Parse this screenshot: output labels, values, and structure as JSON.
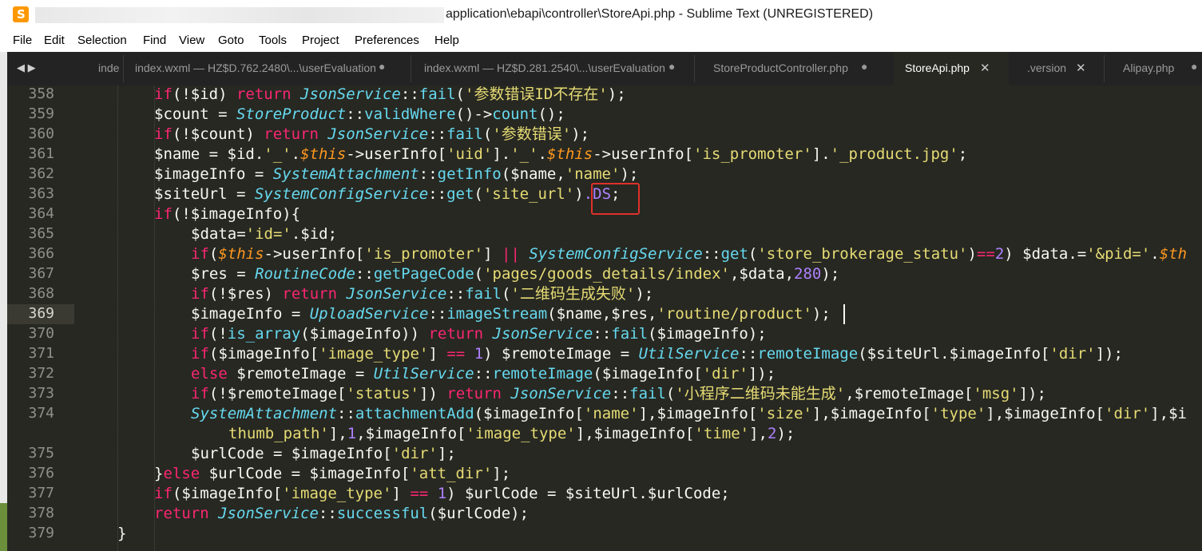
{
  "window": {
    "title": "application\\ebapi\\controller\\StoreApi.php - Sublime Text (UNREGISTERED)",
    "icon": "sublime-icon"
  },
  "menu": [
    "File",
    "Edit",
    "Selection",
    "Find",
    "View",
    "Goto",
    "Tools",
    "Project",
    "Preferences",
    "Help"
  ],
  "tabs": {
    "partial": "inde",
    "items": [
      {
        "label": "index.wxml — HZ$D.762.2480\\...\\userEvaluation",
        "state": "modified"
      },
      {
        "label": "index.wxml — HZ$D.281.2540\\...\\userEvaluation",
        "state": "modified"
      },
      {
        "label": "StoreProductController.php",
        "state": "modified"
      },
      {
        "label": "StoreApi.php",
        "state": "active"
      },
      {
        "label": ".version",
        "state": "close"
      },
      {
        "label": "Alipay.php",
        "state": "modified"
      }
    ]
  },
  "gutter": {
    "line_numbers": [
      "358",
      "359",
      "360",
      "361",
      "362",
      "363",
      "364",
      "365",
      "366",
      "367",
      "368",
      "369",
      "370",
      "371",
      "372",
      "373",
      "374",
      "375",
      "376",
      "377",
      "378",
      "379"
    ],
    "current_line": "369"
  },
  "code": {
    "l358": [
      "if(!$id) ",
      "return ",
      "JsonService",
      "::",
      "fail",
      "(",
      "'参数错误ID不存在'",
      ");"
    ],
    "l359": [
      "$count = ",
      "StoreProduct",
      "::",
      "validWhere",
      "()->",
      "count",
      "();"
    ],
    "l360": [
      "if(!$count) ",
      "return ",
      "JsonService",
      "::",
      "fail",
      "(",
      "'参数错误'",
      ");"
    ],
    "l361": [
      "$name = $id.",
      "'_'",
      ".",
      "$this",
      "->userInfo[",
      "'uid'",
      "].",
      "'_'",
      ".",
      "$this",
      "->userInfo[",
      "'is_promoter'",
      "].",
      "'_product.jpg'",
      ";"
    ],
    "l362": [
      "$imageInfo = ",
      "SystemAttachment",
      "::",
      "getInfo",
      "($name,",
      "'name'",
      ");"
    ],
    "l363": [
      "$siteUrl = ",
      "SystemConfigService",
      "::",
      "get",
      "(",
      "'site_url'",
      ")",
      ".DS",
      ";"
    ],
    "l364": [
      "if(!$imageInfo){"
    ],
    "l365": [
      "$data=",
      "'id='",
      ".$id;"
    ],
    "l366": [
      "if(",
      "$this",
      "->userInfo[",
      "'is_promoter'",
      "] ",
      "||",
      " ",
      "SystemConfigService",
      "::",
      "get",
      "(",
      "'store_brokerage_statu'",
      ")",
      "==",
      "2",
      ") $data.=",
      "'&pid='",
      ".",
      "$th"
    ],
    "l367": [
      "$res = ",
      "RoutineCode",
      "::",
      "getPageCode",
      "(",
      "'pages/goods_details/index'",
      ",$data,",
      "280",
      ");"
    ],
    "l368": [
      "if(!$res) ",
      "return ",
      "JsonService",
      "::",
      "fail",
      "(",
      "'二维码生成失败'",
      ");"
    ],
    "l369": [
      "$imageInfo = ",
      "UploadService",
      "::",
      "imageStream",
      "($name,$res,",
      "'routine/product'",
      ");"
    ],
    "l370": [
      "if(!",
      "is_array",
      "($imageInfo)) ",
      "return ",
      "JsonService",
      "::",
      "fail",
      "($imageInfo);"
    ],
    "l371": [
      "if($imageInfo[",
      "'image_type'",
      "] ",
      "==",
      " ",
      "1",
      ") $remoteImage = ",
      "UtilService",
      "::",
      "remoteImage",
      "($siteUrl.$imageInfo[",
      "'dir'",
      "]);"
    ],
    "l372": [
      "else ",
      "$remoteImage = ",
      "UtilService",
      "::",
      "remoteImage",
      "($imageInfo[",
      "'dir'",
      "]);"
    ],
    "l373": [
      "if(!$remoteImage[",
      "'status'",
      "]) ",
      "return ",
      "JsonService",
      "::",
      "fail",
      "(",
      "'小程序二维码未能生成'",
      ",$remoteImage[",
      "'msg'",
      "]);"
    ],
    "l374": [
      "SystemAttachment",
      "::",
      "attachmentAdd",
      "($imageInfo[",
      "'name'",
      "],$imageInfo[",
      "'size'",
      "],$imageInfo[",
      "'type'",
      "],$imageInfo[",
      "'dir'",
      "],$i"
    ],
    "l374b": [
      "thumb_path'",
      "],",
      "1",
      ",$imageInfo[",
      "'image_type'",
      "],$imageInfo[",
      "'time'",
      "],",
      "2",
      ");"
    ],
    "l375": [
      "$urlCode = $imageInfo[",
      "'dir'",
      "];"
    ],
    "l376": [
      "}",
      "else ",
      "$urlCode = $imageInfo[",
      "'att_dir'",
      "];"
    ],
    "l377": [
      "if($imageInfo[",
      "'image_type'",
      "] ",
      "==",
      " ",
      "1",
      ") $urlCode = $siteUrl.$urlCode;"
    ],
    "l378": [
      "return ",
      "JsonService",
      "::",
      "successful",
      "($urlCode);"
    ],
    "l379": [
      "}"
    ]
  },
  "colors": {
    "background": "#272822",
    "keyword": "#f92672",
    "class": "#66d9ef",
    "string": "#e6db74",
    "number": "#ae81ff",
    "this": "#fd971f",
    "highlight_box": "#e0302a"
  }
}
